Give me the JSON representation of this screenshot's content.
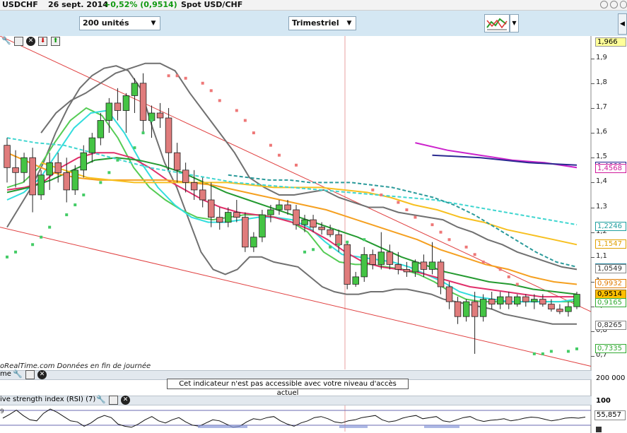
{
  "header": {
    "symbol": "USDCHF",
    "date": "26 sept. 2014",
    "change": "+0,52% (0,9514)",
    "name": "Spot USD/CHF"
  },
  "toolbar": {
    "units": "200 unités",
    "period": "Trimestriel",
    "chart_icon": "chart-style-icon"
  },
  "price_panel": {
    "ymin": 0.65,
    "ymax": 1.99,
    "y_ticks": [
      "1,9",
      "1,8",
      "1,7",
      "1,6",
      "1,5",
      "1,4",
      "1,3",
      "1,2",
      "1,1",
      "1",
      "0,9",
      "0,8",
      "0,7"
    ],
    "tags": [
      {
        "label": "1,966",
        "value": 1.966,
        "bg": "#ffff99",
        "fg": "#000000",
        "border": "#999999"
      },
      {
        "label": "1,4660",
        "value": 1.466,
        "bg": "#ffffff",
        "fg": "#1e1e8c",
        "border": "#1e1e8c"
      },
      {
        "label": "1,4568",
        "value": 1.4568,
        "bg": "#ffffff",
        "fg": "#d01a9c",
        "border": "#d01a9c"
      },
      {
        "label": "1,2246",
        "value": 1.2246,
        "bg": "#ffffff",
        "fg": "#20a0a0",
        "border": "#20a0a0"
      },
      {
        "label": "1,1547",
        "value": 1.1547,
        "bg": "#ffffff",
        "fg": "#e0a000",
        "border": "#e0a000"
      },
      {
        "label": "1,0559",
        "value": 1.0559,
        "bg": "#ffffff",
        "fg": "#1e7f9a",
        "border": "#1e7f9a"
      },
      {
        "label": "1,0549",
        "value": 1.0549,
        "bg": "#ffffff",
        "fg": "#333333",
        "border": "#888888"
      },
      {
        "label": "0,9932",
        "value": 0.9932,
        "bg": "#ffffff",
        "fg": "#e07a00",
        "border": "#e07a00"
      },
      {
        "label": "0,9514",
        "value": 0.9514,
        "bg": "#ffc000",
        "fg": "#000000",
        "border": "#a07000"
      },
      {
        "label": "0,9165",
        "value": 0.9165,
        "bg": "#ffffff",
        "fg": "#33aa33",
        "border": "#33aa33"
      },
      {
        "label": "0,8265",
        "value": 0.8265,
        "bg": "#ffffff",
        "fg": "#333333",
        "border": "#888888"
      },
      {
        "label": "0,7335",
        "value": 0.7335,
        "bg": "#ffffff",
        "fg": "#33aa33",
        "border": "#33aa33"
      }
    ],
    "footer": "oRealTime.com  Données en fin de journée"
  },
  "volume_panel": {
    "label": "me",
    "scale": "200 000",
    "notice": "Cet indicateur n'est pas accessible avec votre niveau d'accès actuel"
  },
  "rsi_panel": {
    "label": "ive strength index (RSI) (7)",
    "scale_top": "100",
    "value": "55,857",
    "left_tag": "9"
  },
  "colors": {
    "bull": "#44c444",
    "bear": "#e07c7c",
    "bollinger": "#707070",
    "trendline": "#e04040",
    "sar_bull": "#44cc66",
    "sar_bear": "#ee7777"
  },
  "chart_data": {
    "type": "candlestick",
    "title": "USDCHF",
    "ylim": [
      0.65,
      1.99
    ],
    "candles": [
      [
        1.55,
        1.58,
        1.4,
        1.46
      ],
      [
        1.46,
        1.53,
        1.38,
        1.44
      ],
      [
        1.44,
        1.52,
        1.4,
        1.5
      ],
      [
        1.5,
        1.54,
        1.28,
        1.35
      ],
      [
        1.35,
        1.45,
        1.33,
        1.43
      ],
      [
        1.43,
        1.52,
        1.37,
        1.48
      ],
      [
        1.48,
        1.52,
        1.4,
        1.44
      ],
      [
        1.44,
        1.5,
        1.32,
        1.37
      ],
      [
        1.37,
        1.47,
        1.35,
        1.45
      ],
      [
        1.45,
        1.55,
        1.42,
        1.52
      ],
      [
        1.52,
        1.6,
        1.48,
        1.58
      ],
      [
        1.58,
        1.68,
        1.55,
        1.65
      ],
      [
        1.65,
        1.74,
        1.6,
        1.72
      ],
      [
        1.72,
        1.78,
        1.65,
        1.69
      ],
      [
        1.69,
        1.76,
        1.6,
        1.75
      ],
      [
        1.75,
        1.82,
        1.68,
        1.8
      ],
      [
        1.8,
        1.84,
        1.6,
        1.65
      ],
      [
        1.65,
        1.71,
        1.58,
        1.68
      ],
      [
        1.68,
        1.72,
        1.62,
        1.66
      ],
      [
        1.66,
        1.7,
        1.45,
        1.52
      ],
      [
        1.52,
        1.56,
        1.4,
        1.45
      ],
      [
        1.45,
        1.48,
        1.36,
        1.4
      ],
      [
        1.4,
        1.45,
        1.33,
        1.37
      ],
      [
        1.37,
        1.42,
        1.3,
        1.33
      ],
      [
        1.33,
        1.4,
        1.22,
        1.26
      ],
      [
        1.26,
        1.3,
        1.21,
        1.24
      ],
      [
        1.24,
        1.3,
        1.22,
        1.28
      ],
      [
        1.28,
        1.33,
        1.24,
        1.26
      ],
      [
        1.26,
        1.28,
        1.12,
        1.14
      ],
      [
        1.14,
        1.2,
        1.12,
        1.18
      ],
      [
        1.18,
        1.29,
        1.16,
        1.27
      ],
      [
        1.27,
        1.31,
        1.24,
        1.29
      ],
      [
        1.29,
        1.33,
        1.27,
        1.31
      ],
      [
        1.31,
        1.33,
        1.27,
        1.29
      ],
      [
        1.29,
        1.31,
        1.21,
        1.23
      ],
      [
        1.23,
        1.27,
        1.2,
        1.25
      ],
      [
        1.25,
        1.27,
        1.2,
        1.22
      ],
      [
        1.22,
        1.24,
        1.19,
        1.21
      ],
      [
        1.21,
        1.23,
        1.18,
        1.19
      ],
      [
        1.19,
        1.21,
        1.12,
        1.15
      ],
      [
        1.15,
        1.16,
        0.97,
        0.99
      ],
      [
        0.99,
        1.04,
        0.98,
        1.02
      ],
      [
        1.02,
        1.14,
        1.0,
        1.11
      ],
      [
        1.11,
        1.13,
        1.05,
        1.07
      ],
      [
        1.07,
        1.2,
        1.05,
        1.12
      ],
      [
        1.12,
        1.15,
        1.05,
        1.07
      ],
      [
        1.07,
        1.12,
        1.03,
        1.05
      ],
      [
        1.05,
        1.08,
        1.02,
        1.04
      ],
      [
        1.04,
        1.09,
        1.02,
        1.08
      ],
      [
        1.08,
        1.11,
        1.02,
        1.05
      ],
      [
        1.05,
        1.16,
        1.03,
        1.08
      ],
      [
        1.08,
        1.09,
        0.95,
        0.98
      ],
      [
        0.98,
        1.0,
        0.89,
        0.92
      ],
      [
        0.92,
        0.94,
        0.83,
        0.86
      ],
      [
        0.86,
        0.93,
        0.84,
        0.92
      ],
      [
        0.92,
        0.96,
        0.71,
        0.86
      ],
      [
        0.86,
        0.95,
        0.84,
        0.93
      ],
      [
        0.93,
        0.96,
        0.89,
        0.91
      ],
      [
        0.91,
        0.96,
        0.89,
        0.94
      ],
      [
        0.94,
        0.96,
        0.89,
        0.91
      ],
      [
        0.91,
        0.95,
        0.9,
        0.94
      ],
      [
        0.94,
        0.95,
        0.9,
        0.92
      ],
      [
        0.92,
        0.95,
        0.89,
        0.93
      ],
      [
        0.93,
        0.95,
        0.9,
        0.91
      ],
      [
        0.91,
        0.93,
        0.88,
        0.89
      ],
      [
        0.89,
        0.91,
        0.87,
        0.88
      ],
      [
        0.88,
        0.92,
        0.86,
        0.9
      ],
      [
        0.9,
        0.96,
        0.89,
        0.95
      ]
    ],
    "indicators": [
      {
        "color": "#707070",
        "values": [
          1.22,
          1.3,
          1.38,
          1.48,
          1.6,
          1.7,
          1.78,
          1.83,
          1.86,
          1.87,
          1.85,
          1.78,
          1.62,
          1.48,
          1.38,
          1.25,
          1.12,
          1.05,
          1.03,
          1.05,
          1.1,
          1.1,
          1.08,
          1.07,
          1.06,
          1.02,
          0.98,
          0.96,
          0.95,
          0.95,
          0.96,
          0.96,
          0.97,
          0.97,
          0.96,
          0.95,
          0.93,
          0.92,
          0.91,
          0.9,
          0.89,
          0.87,
          0.86,
          0.85,
          0.84,
          0.83,
          0.83,
          0.83
        ]
      },
      {
        "color": "#707070",
        "values": [
          1.6,
          1.68,
          1.73,
          1.76,
          1.8,
          1.84,
          1.86,
          1.88,
          1.88,
          1.85,
          1.76,
          1.68,
          1.6,
          1.52,
          1.42,
          1.38,
          1.35,
          1.35,
          1.36,
          1.37,
          1.34,
          1.32,
          1.3,
          1.3,
          1.28,
          1.27,
          1.26,
          1.25,
          1.22,
          1.2,
          1.17,
          1.15,
          1.12,
          1.1,
          1.08,
          1.06,
          1.05
        ]
      },
      {
        "color": "#55cc55",
        "values": [
          1.38,
          1.4,
          1.46,
          1.56,
          1.65,
          1.7,
          1.67,
          1.58,
          1.46,
          1.38,
          1.33,
          1.29,
          1.26,
          1.25,
          1.26,
          1.27,
          1.27,
          1.26,
          1.24,
          1.2,
          1.12,
          1.08,
          1.07,
          1.07,
          1.06,
          1.05,
          1.03,
          1.0,
          0.96,
          0.93,
          0.92,
          0.92,
          0.92,
          0.92,
          0.92,
          0.92,
          0.92
        ]
      },
      {
        "color": "#33dddd",
        "values": [
          1.33,
          1.36,
          1.42,
          1.52,
          1.62,
          1.68,
          1.69,
          1.6,
          1.48,
          1.38,
          1.31,
          1.26,
          1.24,
          1.24,
          1.25,
          1.26,
          1.26,
          1.25,
          1.22,
          1.16,
          1.11,
          1.1,
          1.09,
          1.08,
          1.06,
          1.03,
          1.0,
          0.96,
          0.94,
          0.93,
          0.92,
          0.92,
          0.92,
          0.92,
          0.93
        ]
      },
      {
        "color": "#e0306a",
        "values": [
          1.37,
          1.38,
          1.4,
          1.46,
          1.5,
          1.52,
          1.52,
          1.5,
          1.46,
          1.41,
          1.37,
          1.33,
          1.3,
          1.28,
          1.27,
          1.26,
          1.24,
          1.21,
          1.17,
          1.12,
          1.08,
          1.06,
          1.05,
          1.04,
          1.02,
          1.0,
          0.98,
          0.97,
          0.96,
          0.95,
          0.94,
          0.94,
          0.94
        ]
      },
      {
        "color": "#249a30",
        "values": [
          1.36,
          1.38,
          1.41,
          1.45,
          1.49,
          1.5,
          1.49,
          1.47,
          1.44,
          1.4,
          1.36,
          1.33,
          1.3,
          1.27,
          1.24,
          1.21,
          1.18,
          1.14,
          1.1,
          1.07,
          1.04,
          1.02,
          1.0,
          0.99,
          0.97,
          0.96,
          0.95
        ]
      },
      {
        "color": "#f5a020",
        "values": [
          1.52,
          1.48,
          1.44,
          1.42,
          1.41,
          1.41,
          1.41,
          1.41,
          1.4,
          1.39,
          1.37,
          1.35,
          1.33,
          1.31,
          1.29,
          1.26,
          1.23,
          1.2,
          1.17,
          1.13,
          1.1,
          1.07,
          1.05,
          1.02,
          1.0,
          0.99
        ]
      },
      {
        "color": "#f7c020",
        "values": [
          1.48,
          1.45,
          1.42,
          1.41,
          1.4,
          1.4,
          1.4,
          1.4,
          1.4,
          1.39,
          1.38,
          1.38,
          1.38,
          1.37,
          1.36,
          1.34,
          1.31,
          1.29,
          1.26,
          1.24,
          1.21,
          1.19,
          1.17,
          1.15
        ]
      },
      {
        "color": "#40d6d0",
        "values": [
          1.58,
          1.56,
          1.55,
          1.52,
          1.49,
          1.46,
          1.44,
          1.42,
          1.4,
          1.39,
          1.38,
          1.37,
          1.36,
          1.35,
          1.34,
          1.33,
          1.31,
          1.29,
          1.27,
          1.25,
          1.23
        ]
      },
      {
        "color": "#2a9a9a",
        "values": [
          1.43,
          1.42,
          1.41,
          1.41,
          1.4,
          1.4,
          1.4,
          1.39,
          1.38,
          1.36,
          1.34,
          1.31,
          1.27,
          1.22,
          1.17,
          1.12,
          1.08,
          1.06
        ]
      },
      {
        "color": "#cc22cc",
        "values": [
          1.56,
          1.53,
          1.51,
          1.49,
          1.48,
          1.46
        ]
      },
      {
        "color": "#2a2a90",
        "values": [
          1.51,
          1.5,
          1.48,
          1.47
        ]
      }
    ],
    "sar": [
      {
        "value": 1.1,
        "trend": "bull"
      },
      {
        "value": 1.12,
        "trend": "bull"
      },
      {
        "value": 1.15,
        "trend": "bull"
      },
      {
        "value": 1.18,
        "trend": "bull"
      },
      {
        "value": 1.22,
        "trend": "bull"
      },
      {
        "value": 1.27,
        "trend": "bull"
      },
      {
        "value": 1.31,
        "trend": "bull"
      },
      {
        "value": 1.35,
        "trend": "bull"
      },
      {
        "value": 1.4,
        "trend": "bull"
      },
      {
        "value": 1.44,
        "trend": "bull"
      },
      {
        "value": 1.49,
        "trend": "bull"
      },
      {
        "value": 1.54,
        "trend": "bull"
      },
      {
        "value": 1.6,
        "trend": "bull"
      },
      {
        "value": 1.65,
        "trend": "bull"
      },
      {
        "value": 1.83,
        "trend": "bear"
      },
      {
        "value": 1.83,
        "trend": "bear"
      },
      {
        "value": 1.82,
        "trend": "bear"
      },
      {
        "value": 1.8,
        "trend": "bear"
      },
      {
        "value": 1.77,
        "trend": "bear"
      },
      {
        "value": 1.73,
        "trend": "bear"
      },
      {
        "value": 1.69,
        "trend": "bear"
      },
      {
        "value": 1.65,
        "trend": "bear"
      },
      {
        "value": 1.6,
        "trend": "bear"
      },
      {
        "value": 1.55,
        "trend": "bear"
      },
      {
        "value": 1.51,
        "trend": "bear"
      },
      {
        "value": 1.47,
        "trend": "bear"
      },
      {
        "value": 1.12,
        "trend": "bull"
      },
      {
        "value": 1.13,
        "trend": "bull"
      },
      {
        "value": 1.14,
        "trend": "bull"
      },
      {
        "value": 1.15,
        "trend": "bull"
      },
      {
        "value": 1.16,
        "trend": "bull"
      },
      {
        "value": 1.17,
        "trend": "bull"
      },
      {
        "value": 1.37,
        "trend": "bear"
      },
      {
        "value": 1.35,
        "trend": "bear"
      },
      {
        "value": 1.32,
        "trend": "bear"
      },
      {
        "value": 1.29,
        "trend": "bear"
      },
      {
        "value": 1.26,
        "trend": "bear"
      },
      {
        "value": 1.23,
        "trend": "bear"
      },
      {
        "value": 1.2,
        "trend": "bear"
      },
      {
        "value": 1.17,
        "trend": "bear"
      },
      {
        "value": 1.14,
        "trend": "bear"
      },
      {
        "value": 1.11,
        "trend": "bear"
      },
      {
        "value": 1.08,
        "trend": "bear"
      },
      {
        "value": 1.05,
        "trend": "bear"
      },
      {
        "value": 1.02,
        "trend": "bear"
      },
      {
        "value": 0.99,
        "trend": "bear"
      },
      {
        "value": 0.71,
        "trend": "bull"
      },
      {
        "value": 0.71,
        "trend": "bull"
      },
      {
        "value": 0.72,
        "trend": "bull"
      },
      {
        "value": 0.72,
        "trend": "bull"
      },
      {
        "value": 0.73,
        "trend": "bull"
      }
    ],
    "rsi": [
      55,
      62,
      70,
      60,
      52,
      50,
      64,
      72,
      66,
      58,
      50,
      48,
      40,
      46,
      55,
      60,
      56,
      44,
      40,
      38,
      44,
      52,
      58,
      50,
      46,
      52,
      56,
      48,
      42,
      40,
      46,
      52,
      50,
      44,
      38,
      40,
      48,
      54,
      52,
      56,
      58,
      50,
      44,
      40,
      46,
      50,
      56,
      58,
      54,
      48,
      46,
      50,
      52,
      56,
      58,
      60,
      52,
      48,
      50,
      55,
      58,
      60,
      54,
      56,
      58,
      50,
      48,
      52,
      56,
      58,
      52,
      49,
      51,
      52,
      54,
      50,
      52,
      55,
      57,
      56,
      53,
      50,
      52,
      55,
      56,
      55,
      57
    ]
  }
}
